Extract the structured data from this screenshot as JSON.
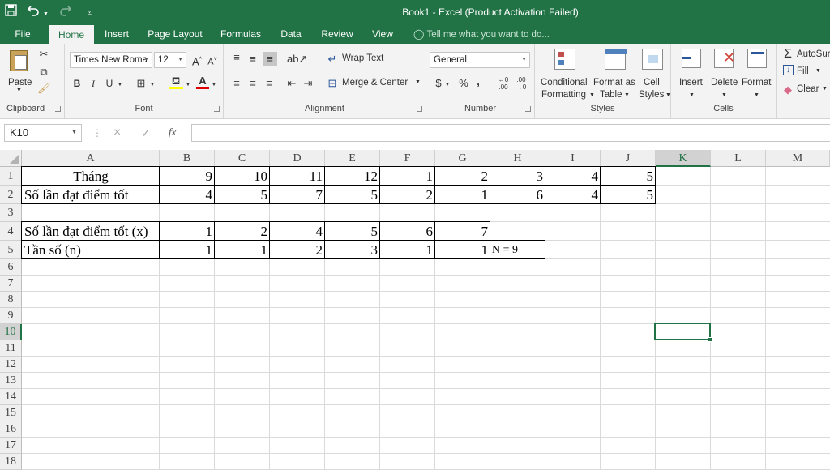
{
  "app": {
    "title": "Book1 - Excel (Product Activation Failed)",
    "accent": "#217346"
  },
  "quick_access": {
    "save_icon": "save-icon",
    "undo_icon": "undo-icon",
    "redo_icon": "redo-icon",
    "customize_icon": "customize-icon"
  },
  "tabs": [
    "File",
    "Home",
    "Insert",
    "Page Layout",
    "Formulas",
    "Data",
    "Review",
    "View"
  ],
  "active_tab": "Home",
  "tell_me": "Tell me what you want to do...",
  "ribbon": {
    "clipboard": {
      "paste": "Paste",
      "group": "Clipboard"
    },
    "font": {
      "name": "Times New Roma",
      "size": "12",
      "bold": "B",
      "italic": "I",
      "underline": "U",
      "group": "Font"
    },
    "alignment": {
      "wrap": "Wrap Text",
      "merge": "Merge & Center",
      "group": "Alignment"
    },
    "number": {
      "format": "General",
      "currency": "$",
      "percent": "%",
      "comma": ",",
      "group": "Number"
    },
    "styles": {
      "conditional_1": "Conditional",
      "conditional_2": "Formatting",
      "format_as_1": "Format as",
      "format_as_2": "Table",
      "cell_1": "Cell",
      "cell_2": "Styles",
      "group": "Styles"
    },
    "cells": {
      "insert": "Insert",
      "delete": "Delete",
      "format": "Format",
      "group": "Cells"
    },
    "editing": {
      "autosum": "AutoSur",
      "fill": "Fill",
      "clear": "Clear"
    }
  },
  "formula_bar": {
    "name_box": "K10",
    "cancel": "×",
    "enter": "✓",
    "fx": "fx",
    "content": ""
  },
  "sheet": {
    "columns": [
      "A",
      "B",
      "C",
      "D",
      "E",
      "F",
      "G",
      "H",
      "I",
      "J",
      "K",
      "L",
      "M"
    ],
    "rows": [
      "1",
      "2",
      "3",
      "4",
      "5",
      "6",
      "7",
      "8",
      "9",
      "10",
      "11",
      "12",
      "13",
      "14",
      "15",
      "16",
      "17",
      "18"
    ],
    "selected_cell": "K10",
    "cells": [
      [
        "Tháng",
        "9",
        "10",
        "11",
        "12",
        "1",
        "2",
        "3",
        "4",
        "5"
      ],
      [
        "Số lần đạt điểm tốt",
        "4",
        "5",
        "7",
        "5",
        "2",
        "1",
        "6",
        "4",
        "5"
      ],
      [],
      [
        "Số lần đạt điểm tốt (x)",
        "1",
        "2",
        "4",
        "5",
        "6",
        "7"
      ],
      [
        "Tần số (n)",
        "1",
        "1",
        "2",
        "3",
        "1",
        "1",
        "N = 9"
      ]
    ]
  }
}
